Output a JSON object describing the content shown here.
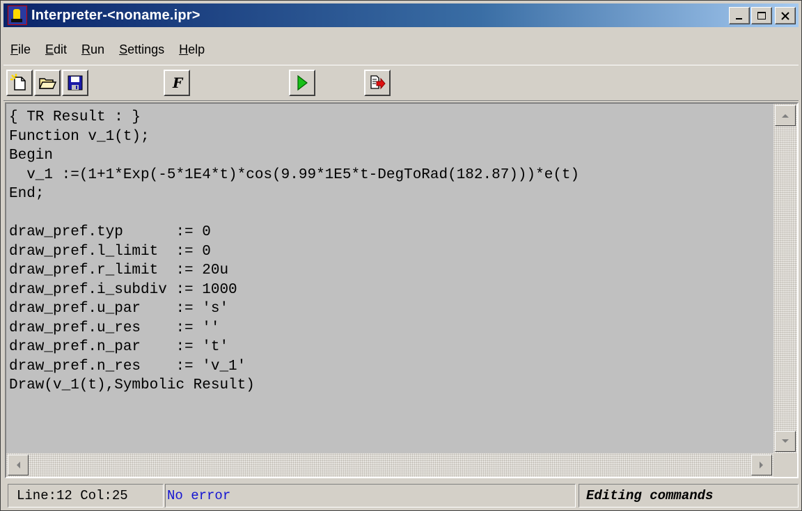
{
  "window": {
    "title": "Interpreter-<noname.ipr>",
    "controls": {
      "minimize": "_",
      "maximize": "□",
      "close": "✕"
    }
  },
  "menu": {
    "items": [
      {
        "label": "File",
        "accel": "F",
        "rest": "ile"
      },
      {
        "label": "Edit",
        "accel": "E",
        "rest": "dit"
      },
      {
        "label": "Run",
        "accel": "R",
        "rest": "un"
      },
      {
        "label": "Settings",
        "accel": "S",
        "rest": "ettings"
      },
      {
        "label": "Help",
        "accel": "H",
        "rest": "elp"
      }
    ]
  },
  "toolbar": {
    "buttons": [
      {
        "name": "new-file",
        "icon": "new-document-icon"
      },
      {
        "name": "open-file",
        "icon": "open-folder-icon"
      },
      {
        "name": "save-file",
        "icon": "floppy-disk-icon"
      },
      {
        "name": "function",
        "icon": "function-f-icon"
      },
      {
        "name": "run",
        "icon": "play-icon"
      },
      {
        "name": "exit",
        "icon": "exit-document-icon"
      }
    ]
  },
  "editor": {
    "lines": [
      "{ TR Result : }",
      "Function v_1(t);",
      "Begin",
      "  v_1 :=(1+1*Exp(-5*1E4*t)*cos(9.99*1E5*t-DegToRad(182.87)))*e(t)",
      "End;",
      "",
      "draw_pref.typ      := 0",
      "draw_pref.l_limit  := 0",
      "draw_pref.r_limit  := 20u",
      "draw_pref.i_subdiv := 1000",
      "draw_pref.u_par    := 's'",
      "draw_pref.u_res    := ''",
      "draw_pref.n_par    := 't'",
      "draw_pref.n_res    := 'v_1'",
      "Draw(v_1(t),Symbolic Result)"
    ]
  },
  "status": {
    "position": "Line:12 Col:25",
    "error": "No error",
    "mode": "Editing commands"
  }
}
